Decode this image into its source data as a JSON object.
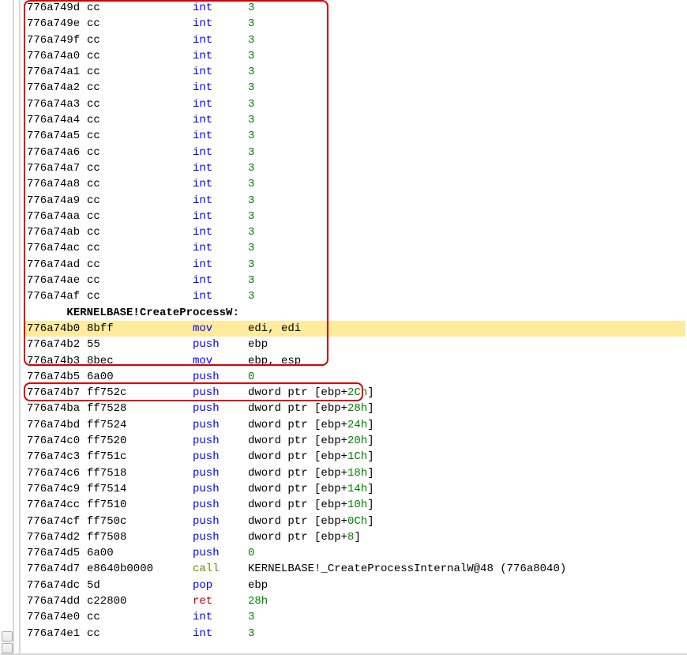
{
  "symbol_label": "KERNELBASE!CreateProcessW:",
  "rows": [
    {
      "addr": "776a749d",
      "bytes": "cc",
      "mnem": "int",
      "mnemCls": "mnem-blue",
      "ops": [
        {
          "t": "3",
          "cls": "num"
        }
      ],
      "hl": false
    },
    {
      "addr": "776a749e",
      "bytes": "cc",
      "mnem": "int",
      "mnemCls": "mnem-blue",
      "ops": [
        {
          "t": "3",
          "cls": "num"
        }
      ],
      "hl": false
    },
    {
      "addr": "776a749f",
      "bytes": "cc",
      "mnem": "int",
      "mnemCls": "mnem-blue",
      "ops": [
        {
          "t": "3",
          "cls": "num"
        }
      ],
      "hl": false
    },
    {
      "addr": "776a74a0",
      "bytes": "cc",
      "mnem": "int",
      "mnemCls": "mnem-blue",
      "ops": [
        {
          "t": "3",
          "cls": "num"
        }
      ],
      "hl": false
    },
    {
      "addr": "776a74a1",
      "bytes": "cc",
      "mnem": "int",
      "mnemCls": "mnem-blue",
      "ops": [
        {
          "t": "3",
          "cls": "num"
        }
      ],
      "hl": false
    },
    {
      "addr": "776a74a2",
      "bytes": "cc",
      "mnem": "int",
      "mnemCls": "mnem-blue",
      "ops": [
        {
          "t": "3",
          "cls": "num"
        }
      ],
      "hl": false
    },
    {
      "addr": "776a74a3",
      "bytes": "cc",
      "mnem": "int",
      "mnemCls": "mnem-blue",
      "ops": [
        {
          "t": "3",
          "cls": "num"
        }
      ],
      "hl": false
    },
    {
      "addr": "776a74a4",
      "bytes": "cc",
      "mnem": "int",
      "mnemCls": "mnem-blue",
      "ops": [
        {
          "t": "3",
          "cls": "num"
        }
      ],
      "hl": false
    },
    {
      "addr": "776a74a5",
      "bytes": "cc",
      "mnem": "int",
      "mnemCls": "mnem-blue",
      "ops": [
        {
          "t": "3",
          "cls": "num"
        }
      ],
      "hl": false
    },
    {
      "addr": "776a74a6",
      "bytes": "cc",
      "mnem": "int",
      "mnemCls": "mnem-blue",
      "ops": [
        {
          "t": "3",
          "cls": "num"
        }
      ],
      "hl": false
    },
    {
      "addr": "776a74a7",
      "bytes": "cc",
      "mnem": "int",
      "mnemCls": "mnem-blue",
      "ops": [
        {
          "t": "3",
          "cls": "num"
        }
      ],
      "hl": false
    },
    {
      "addr": "776a74a8",
      "bytes": "cc",
      "mnem": "int",
      "mnemCls": "mnem-blue",
      "ops": [
        {
          "t": "3",
          "cls": "num"
        }
      ],
      "hl": false
    },
    {
      "addr": "776a74a9",
      "bytes": "cc",
      "mnem": "int",
      "mnemCls": "mnem-blue",
      "ops": [
        {
          "t": "3",
          "cls": "num"
        }
      ],
      "hl": false
    },
    {
      "addr": "776a74aa",
      "bytes": "cc",
      "mnem": "int",
      "mnemCls": "mnem-blue",
      "ops": [
        {
          "t": "3",
          "cls": "num"
        }
      ],
      "hl": false
    },
    {
      "addr": "776a74ab",
      "bytes": "cc",
      "mnem": "int",
      "mnemCls": "mnem-blue",
      "ops": [
        {
          "t": "3",
          "cls": "num"
        }
      ],
      "hl": false
    },
    {
      "addr": "776a74ac",
      "bytes": "cc",
      "mnem": "int",
      "mnemCls": "mnem-blue",
      "ops": [
        {
          "t": "3",
          "cls": "num"
        }
      ],
      "hl": false
    },
    {
      "addr": "776a74ad",
      "bytes": "cc",
      "mnem": "int",
      "mnemCls": "mnem-blue",
      "ops": [
        {
          "t": "3",
          "cls": "num"
        }
      ],
      "hl": false
    },
    {
      "addr": "776a74ae",
      "bytes": "cc",
      "mnem": "int",
      "mnemCls": "mnem-blue",
      "ops": [
        {
          "t": "3",
          "cls": "num"
        }
      ],
      "hl": false
    },
    {
      "addr": "776a74af",
      "bytes": "cc",
      "mnem": "int",
      "mnemCls": "mnem-blue",
      "ops": [
        {
          "t": "3",
          "cls": "num"
        }
      ],
      "hl": false
    },
    {
      "symLine": true
    },
    {
      "addr": "776a74b0",
      "bytes": "8bff",
      "mnem": "mov",
      "mnemCls": "mnem-blue",
      "ops": [
        {
          "t": "edi, edi",
          "cls": "reg"
        }
      ],
      "hl": true
    },
    {
      "addr": "776a74b2",
      "bytes": "55",
      "mnem": "push",
      "mnemCls": "mnem-blue",
      "ops": [
        {
          "t": "ebp",
          "cls": "reg"
        }
      ],
      "hl": false
    },
    {
      "addr": "776a74b3",
      "bytes": "8bec",
      "mnem": "mov",
      "mnemCls": "mnem-blue",
      "ops": [
        {
          "t": "ebp, esp",
          "cls": "reg"
        }
      ],
      "hl": false
    },
    {
      "addr": "776a74b5",
      "bytes": "6a00",
      "mnem": "push",
      "mnemCls": "mnem-blue",
      "ops": [
        {
          "t": "0",
          "cls": "num"
        }
      ],
      "hl": false
    },
    {
      "addr": "776a74b7",
      "bytes": "ff752c",
      "mnem": "push",
      "mnemCls": "mnem-blue",
      "ops": [
        {
          "t": "dword ptr [ebp+",
          "cls": "reg"
        },
        {
          "t": "2Ch",
          "cls": "num"
        },
        {
          "t": "]",
          "cls": "reg"
        }
      ],
      "hl": false
    },
    {
      "addr": "776a74ba",
      "bytes": "ff7528",
      "mnem": "push",
      "mnemCls": "mnem-blue",
      "ops": [
        {
          "t": "dword ptr [ebp+",
          "cls": "reg"
        },
        {
          "t": "28h",
          "cls": "num"
        },
        {
          "t": "]",
          "cls": "reg"
        }
      ],
      "hl": false
    },
    {
      "addr": "776a74bd",
      "bytes": "ff7524",
      "mnem": "push",
      "mnemCls": "mnem-blue",
      "ops": [
        {
          "t": "dword ptr [ebp+",
          "cls": "reg"
        },
        {
          "t": "24h",
          "cls": "num"
        },
        {
          "t": "]",
          "cls": "reg"
        }
      ],
      "hl": false
    },
    {
      "addr": "776a74c0",
      "bytes": "ff7520",
      "mnem": "push",
      "mnemCls": "mnem-blue",
      "ops": [
        {
          "t": "dword ptr [ebp+",
          "cls": "reg"
        },
        {
          "t": "20h",
          "cls": "num"
        },
        {
          "t": "]",
          "cls": "reg"
        }
      ],
      "hl": false
    },
    {
      "addr": "776a74c3",
      "bytes": "ff751c",
      "mnem": "push",
      "mnemCls": "mnem-blue",
      "ops": [
        {
          "t": "dword ptr [ebp+",
          "cls": "reg"
        },
        {
          "t": "1Ch",
          "cls": "num"
        },
        {
          "t": "]",
          "cls": "reg"
        }
      ],
      "hl": false
    },
    {
      "addr": "776a74c6",
      "bytes": "ff7518",
      "mnem": "push",
      "mnemCls": "mnem-blue",
      "ops": [
        {
          "t": "dword ptr [ebp+",
          "cls": "reg"
        },
        {
          "t": "18h",
          "cls": "num"
        },
        {
          "t": "]",
          "cls": "reg"
        }
      ],
      "hl": false
    },
    {
      "addr": "776a74c9",
      "bytes": "ff7514",
      "mnem": "push",
      "mnemCls": "mnem-blue",
      "ops": [
        {
          "t": "dword ptr [ebp+",
          "cls": "reg"
        },
        {
          "t": "14h",
          "cls": "num"
        },
        {
          "t": "]",
          "cls": "reg"
        }
      ],
      "hl": false
    },
    {
      "addr": "776a74cc",
      "bytes": "ff7510",
      "mnem": "push",
      "mnemCls": "mnem-blue",
      "ops": [
        {
          "t": "dword ptr [ebp+",
          "cls": "reg"
        },
        {
          "t": "10h",
          "cls": "num"
        },
        {
          "t": "]",
          "cls": "reg"
        }
      ],
      "hl": false
    },
    {
      "addr": "776a74cf",
      "bytes": "ff750c",
      "mnem": "push",
      "mnemCls": "mnem-blue",
      "ops": [
        {
          "t": "dword ptr [ebp+",
          "cls": "reg"
        },
        {
          "t": "0Ch",
          "cls": "num"
        },
        {
          "t": "]",
          "cls": "reg"
        }
      ],
      "hl": false
    },
    {
      "addr": "776a74d2",
      "bytes": "ff7508",
      "mnem": "push",
      "mnemCls": "mnem-blue",
      "ops": [
        {
          "t": "dword ptr [ebp+",
          "cls": "reg"
        },
        {
          "t": "8",
          "cls": "num"
        },
        {
          "t": "]",
          "cls": "reg"
        }
      ],
      "hl": false
    },
    {
      "addr": "776a74d5",
      "bytes": "6a00",
      "mnem": "push",
      "mnemCls": "mnem-blue",
      "ops": [
        {
          "t": "0",
          "cls": "num"
        }
      ],
      "hl": false
    },
    {
      "addr": "776a74d7",
      "bytes": "e8640b0000",
      "mnem": "call",
      "mnemCls": "mnem-olive",
      "ops": [
        {
          "t": "KERNELBASE!_CreateProcessInternalW@48 (776a8040)",
          "cls": "reg"
        }
      ],
      "hl": false
    },
    {
      "addr": "776a74dc",
      "bytes": "5d",
      "mnem": "pop",
      "mnemCls": "mnem-blue",
      "ops": [
        {
          "t": "ebp",
          "cls": "reg"
        }
      ],
      "hl": false
    },
    {
      "addr": "776a74dd",
      "bytes": "c22800",
      "mnem": "ret",
      "mnemCls": "mnem-red",
      "ops": [
        {
          "t": "28h",
          "cls": "num"
        }
      ],
      "hl": false
    },
    {
      "addr": "776a74e0",
      "bytes": "cc",
      "mnem": "int",
      "mnemCls": "mnem-blue",
      "ops": [
        {
          "t": "3",
          "cls": "num"
        }
      ],
      "hl": false
    },
    {
      "addr": "776a74e1",
      "bytes": "cc",
      "mnem": "int",
      "mnemCls": "mnem-blue",
      "ops": [
        {
          "t": "3",
          "cls": "num"
        }
      ],
      "hl": false
    }
  ]
}
